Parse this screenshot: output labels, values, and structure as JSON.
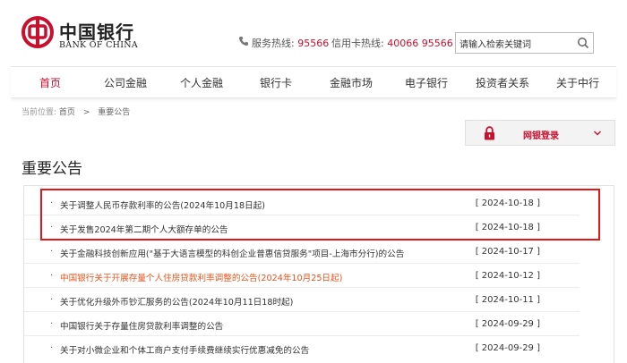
{
  "brand": {
    "name_cn": "中国银行",
    "name_en": "BANK OF CHINA",
    "color": "#c8102e"
  },
  "hotlines": [
    {
      "label": "服务热线:",
      "number": "95566"
    },
    {
      "label": "信用卡热线:",
      "number": "40066 95566"
    }
  ],
  "search": {
    "value": "请输入检索关键词"
  },
  "nav": [
    {
      "label": "首页",
      "active": true
    },
    {
      "label": "公司金融"
    },
    {
      "label": "个人金融"
    },
    {
      "label": "银行卡"
    },
    {
      "label": "金融市场"
    },
    {
      "label": "电子银行"
    },
    {
      "label": "投资者关系"
    },
    {
      "label": "关于中行"
    }
  ],
  "breadcrumb": {
    "label": "当前位置:",
    "home": "首页",
    "separator": ">",
    "current": "重要公告"
  },
  "login": {
    "label": "网银登录"
  },
  "page_title": "重要公告",
  "announcements": [
    {
      "title": "关于调整人民币存款利率的公告(2024年10月18日起)",
      "date": "[ 2024-10-18 ]"
    },
    {
      "title": "关于发售2024年第二期个人大额存单的公告",
      "date": "[ 2024-10-18 ]"
    },
    {
      "title": "关于金融科技创新应用(\"基于大语言模型的科创企业普惠信贷服务\"项目-上海市分行)的公告",
      "date": "[ 2024-10-17 ]"
    },
    {
      "title": "中国银行关于开展存量个人住房贷款利率调整的公告(2024年10月25日起)",
      "date": "[ 2024-10-12 ]",
      "highlight": true
    },
    {
      "title": "关于优化升级外币钞汇服务的公告(2024年10月11日18时起)",
      "date": "[ 2024-10-11 ]"
    },
    {
      "title": "中国银行关于存量住房贷款利率调整的公告",
      "date": "[ 2024-09-29 ]"
    },
    {
      "title": "关于对小微企业和个体工商户支付手续费继续实行优惠减免的公告",
      "date": "[ 2024-09-29 ]"
    }
  ],
  "icons": {
    "logo": "boc-logo-icon",
    "phone": "phone-icon",
    "search": "search-icon",
    "lock": "lock-icon",
    "chevron": "chevron-down-icon"
  },
  "colors": {
    "accent": "#c8102e",
    "highlight_text": "#e8541e",
    "annotation_box": "#e3171a"
  }
}
